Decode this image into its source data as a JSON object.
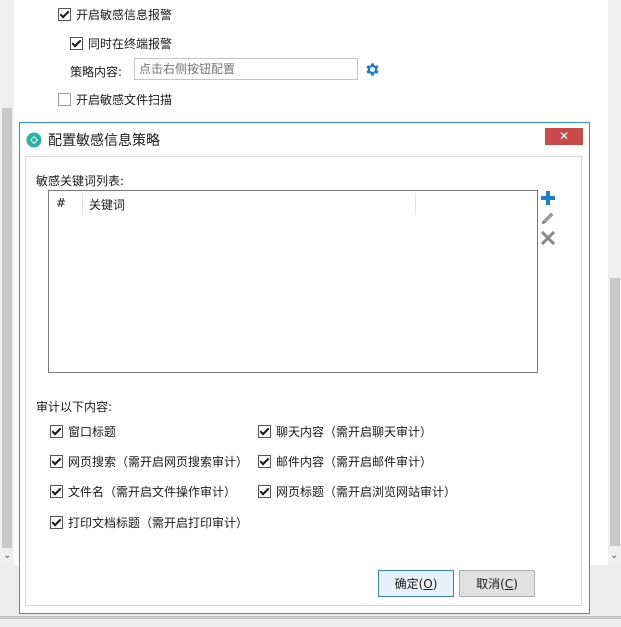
{
  "background": {
    "enable_alert_label": "开启敏感信息报警",
    "enable_alert_checked": true,
    "terminal_alert_label": "同时在终端报警",
    "terminal_alert_checked": true,
    "policy_label": "策略内容:",
    "policy_placeholder": "点击右侧按钮配置",
    "file_scan_label": "开启敏感文件扫描",
    "file_scan_checked": false
  },
  "dialog": {
    "title": "配置敏感信息策略",
    "close_glyph": "✕",
    "keyword_list_label": "敏感关键词列表:",
    "table": {
      "columns": [
        "#",
        "关键词",
        ""
      ]
    },
    "audit_label": "审计以下内容:",
    "audit_options": [
      {
        "label": "窗口标题",
        "checked": true
      },
      {
        "label": "聊天内容（需开启聊天审计）",
        "checked": true
      },
      {
        "label": "网页搜索（需开启网页搜索审计）",
        "checked": true
      },
      {
        "label": "邮件内容（需开启邮件审计）",
        "checked": true
      },
      {
        "label": "文件名（需开启文件操作审计）",
        "checked": true
      },
      {
        "label": "网页标题（需开启浏览网站审计）",
        "checked": true
      },
      {
        "label": "打印文档标题（需开启打印审计）",
        "checked": true
      }
    ],
    "ok_text": "确定(",
    "ok_key": "O",
    "ok_end": ")",
    "cancel_text": "取消(",
    "cancel_key": "C",
    "cancel_end": ")"
  },
  "colors": {
    "dialog_border": "#2f8fcf",
    "close_button": "#c74b4b",
    "add_icon": "#1e7fc8",
    "gear_icon": "#1e7fc8",
    "title_icon": "#26b3a0"
  },
  "icons": [
    "gear-icon",
    "add-icon",
    "edit-icon",
    "delete-icon",
    "dialog-logo-icon",
    "close-icon"
  ]
}
